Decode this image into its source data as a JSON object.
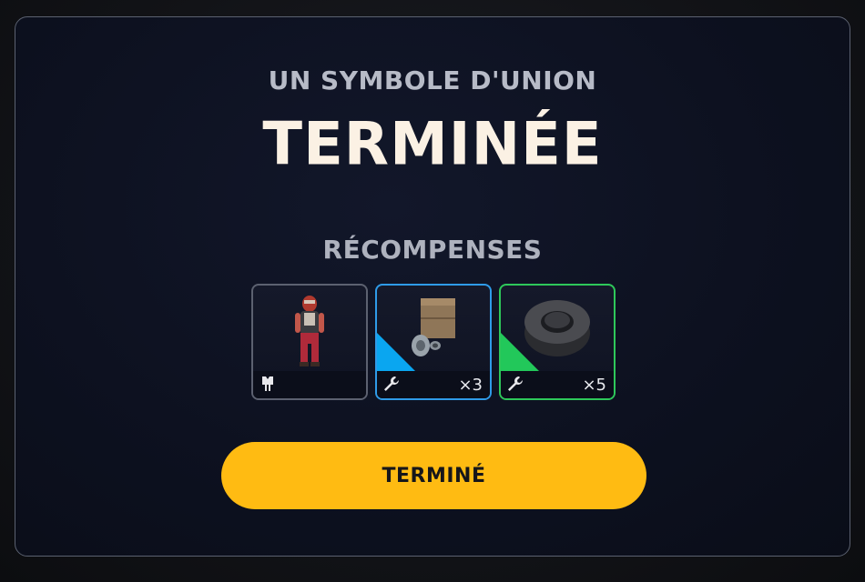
{
  "header": {
    "subtitle": "UN SYMBOLE D'UNION",
    "title": "TERMINÉE"
  },
  "rewards": {
    "heading": "RÉCOMPENSES",
    "items": [
      {
        "kind": "outfit",
        "type_icon": "outfit-icon",
        "rarity_color": "#5c6170",
        "quantity": ""
      },
      {
        "kind": "crafting-material",
        "type_icon": "wrench-icon",
        "rarity_color": "#0aa6f0",
        "quantity": "×3"
      },
      {
        "kind": "crafting-material",
        "type_icon": "wrench-icon",
        "rarity_color": "#22c85a",
        "quantity": "×5"
      }
    ]
  },
  "actions": {
    "done_label": "TERMINÉ"
  },
  "colors": {
    "accent": "#ffbb12",
    "title": "#fbf1e4",
    "rare": "#0aa6f0",
    "uncommon": "#22c85a"
  }
}
